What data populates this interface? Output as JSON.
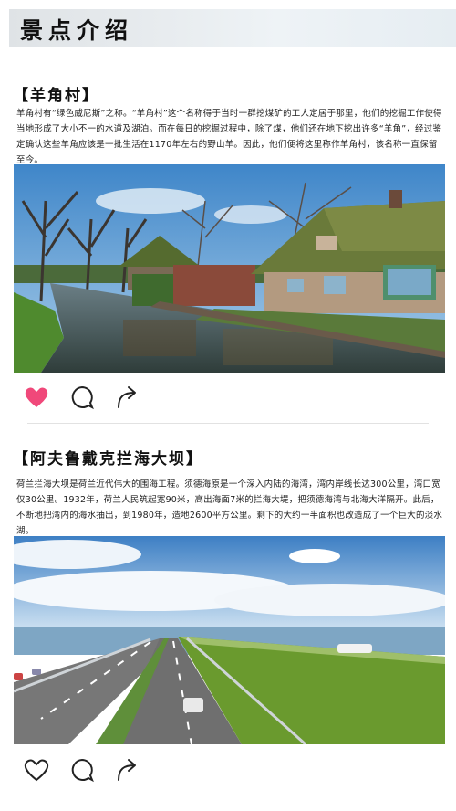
{
  "header": {
    "title": "景点介绍"
  },
  "sections": [
    {
      "title": "【羊角村】",
      "text": "羊角村有“绿色威尼斯”之称。“羊角村”这个名称得于当时一群挖煤矿的工人定居于那里，他们的挖掘工作使得当地形成了大小不一的水道及湖泊。而在每日的挖掘过程中，除了煤，他们还在地下挖出许多“羊角”，经过鉴定确认这些羊角应该是一批生活在1170年左右的野山羊。因此，他们便将这里称作羊角村，该名称一直保留至今。",
      "photo": "village-canal-thatched-houses",
      "actions": {
        "liked": true
      }
    },
    {
      "title": "【阿夫鲁戴克拦海大坝】",
      "text": "荷兰拦海大坝是荷兰近代伟大的围海工程。须德海原是一个深入内陆的海湾，湾内岸线长达300公里，湾口宽仅30公里。1932年，荷兰人民筑起宽90米，高出海面7米的拦海大堤，把须德海湾与北海大洋隔开。此后，不断地把湾内的海水抽出，到1980年，造地2600平方公里。剩下的大约一半面积也改造成了一个巨大的淡水湖。",
      "photo": "afsluitdijk-highway-dam",
      "actions": {
        "liked": false
      }
    }
  ],
  "colors": {
    "like_active": "#f0487a",
    "icon_stroke": "#222222",
    "sky": "#3f86c9",
    "grass": "#6a9a2e"
  }
}
